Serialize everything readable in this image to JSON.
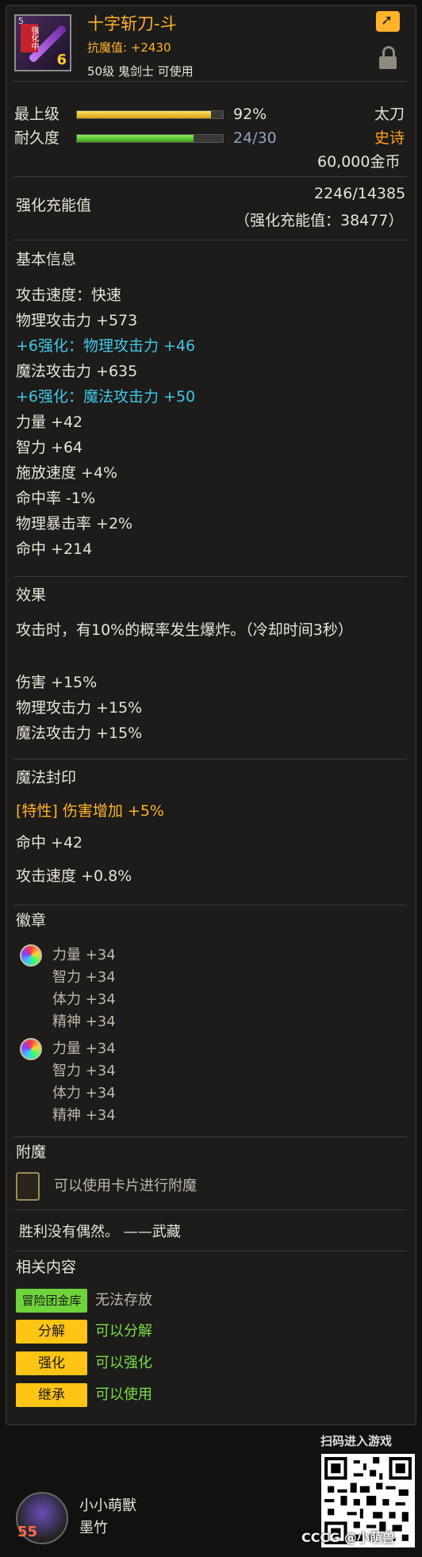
{
  "item": {
    "name": "十字斩刀-斗",
    "resist_label": "抗魔值: +2430",
    "requirement": "50级 鬼剑士 可使用",
    "icon_tag": "强化中",
    "icon_level": "6",
    "icon_top": "5",
    "grade_label": "最上级",
    "grade_percent": "92%",
    "grade_fraction": 0.92,
    "durability_label": "耐久度",
    "durability_value": "24/30",
    "durability_fraction": 0.8,
    "type": "太刀",
    "rarity": "史诗",
    "price": "60,000金币",
    "charge_label": "强化充能值",
    "charge_value": "2246/14385",
    "charge_total": "（强化充能值：38477）"
  },
  "basic": {
    "title": "基本信息",
    "stats": [
      "攻击速度：快速",
      "物理攻击力 +573",
      "+6强化：物理攻击力 +46",
      "魔法攻击力 +635",
      "+6强化：魔法攻击力 +50",
      "力量 +42",
      "智力 +64",
      "施放速度 +4%",
      "命中率 -1%",
      "物理暴击率 +2%",
      "命中 +214"
    ]
  },
  "effect": {
    "title": "效果",
    "desc": "攻击时，有10%的概率发生爆炸。（冷却时间3秒）",
    "lines": [
      "伤害 +15%",
      "物理攻击力 +15%",
      "魔法攻击力 +15%"
    ]
  },
  "seal": {
    "title": "魔法封印",
    "trait": "[特性] 伤害增加 +5%",
    "lines": [
      "命中 +42",
      "攻击速度 +0.8%"
    ]
  },
  "emblem": {
    "title": "徽章",
    "groups": [
      [
        "力量 +34",
        "智力 +34",
        "体力 +34",
        "精神 +34"
      ],
      [
        "力量 +34",
        "智力 +34",
        "体力 +34",
        "精神 +34"
      ]
    ]
  },
  "enchant": {
    "title": "附魔",
    "text": "可以使用卡片进行附魔"
  },
  "flavor": "胜利没有偶然。 ——武藏",
  "related": {
    "title": "相关内容",
    "rows": [
      {
        "button": "冒险团金库",
        "text": "无法存放"
      },
      {
        "button": "分解",
        "text": "可以分解"
      },
      {
        "button": "强化",
        "text": "可以强化"
      },
      {
        "button": "继承",
        "text": "可以使用"
      }
    ]
  },
  "footer": {
    "scan_text": "扫码进入游戏",
    "player_name": "小小萌獸",
    "server": "墨竹",
    "level": "55",
    "watermark": "CCCG @小萌兽"
  },
  "colors": {
    "gold": "#ffb22a",
    "cyan": "#43c6e6",
    "bar_gold": "#f1c21a",
    "bar_green": "#5bc62f"
  }
}
